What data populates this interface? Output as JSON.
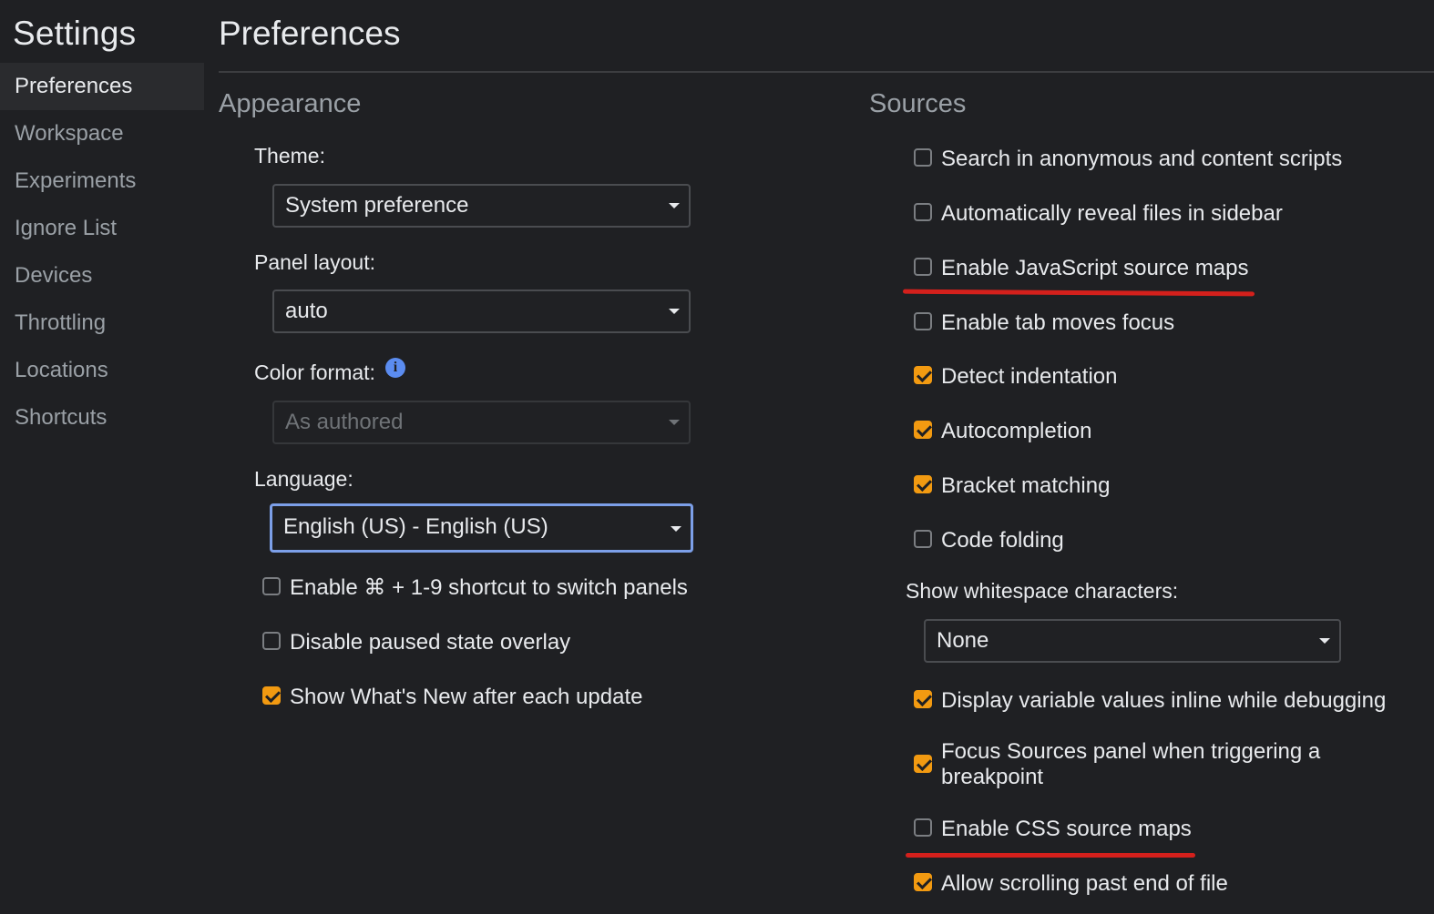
{
  "sidebar": {
    "title": "Settings",
    "items": [
      {
        "label": "Preferences"
      },
      {
        "label": "Workspace"
      },
      {
        "label": "Experiments"
      },
      {
        "label": "Ignore List"
      },
      {
        "label": "Devices"
      },
      {
        "label": "Throttling"
      },
      {
        "label": "Locations"
      },
      {
        "label": "Shortcuts"
      }
    ],
    "active_index": 0
  },
  "main": {
    "title": "Preferences",
    "appearance": {
      "title": "Appearance",
      "theme": {
        "label": "Theme:",
        "value": "System preference"
      },
      "panel_layout": {
        "label": "Panel layout:",
        "value": "auto"
      },
      "color_format": {
        "label": "Color format:",
        "value": "As authored",
        "info_icon": "i"
      },
      "language": {
        "label": "Language:",
        "value": "English (US) - English (US)"
      },
      "checkboxes": [
        {
          "label": "Enable ⌘ + 1-9 shortcut to switch panels",
          "checked": false
        },
        {
          "label": "Disable paused state overlay",
          "checked": false
        },
        {
          "label": "Show What's New after each update",
          "checked": true
        }
      ]
    },
    "sources": {
      "title": "Sources",
      "checkboxes_top": [
        {
          "label": "Search in anonymous and content scripts",
          "checked": false
        },
        {
          "label": "Automatically reveal files in sidebar",
          "checked": false
        },
        {
          "label": "Enable JavaScript source maps",
          "checked": false
        },
        {
          "label": "Enable tab moves focus",
          "checked": false
        },
        {
          "label": "Detect indentation",
          "checked": true
        },
        {
          "label": "Autocompletion",
          "checked": true
        },
        {
          "label": "Bracket matching",
          "checked": true
        },
        {
          "label": "Code folding",
          "checked": false
        }
      ],
      "whitespace": {
        "label": "Show whitespace characters:",
        "value": "None"
      },
      "checkboxes_bottom": [
        {
          "label": "Display variable values inline while debugging",
          "checked": true
        },
        {
          "label": "Focus Sources panel when triggering a breakpoint",
          "checked": true
        },
        {
          "label": "Enable CSS source maps",
          "checked": false
        },
        {
          "label": "Allow scrolling past end of file",
          "checked": true
        }
      ]
    }
  },
  "colors": {
    "background": "#1f2023",
    "checkbox_checked": "#f29a11",
    "annotation_underline": "#d4201c",
    "focus_ring": "#7c9fe8"
  }
}
